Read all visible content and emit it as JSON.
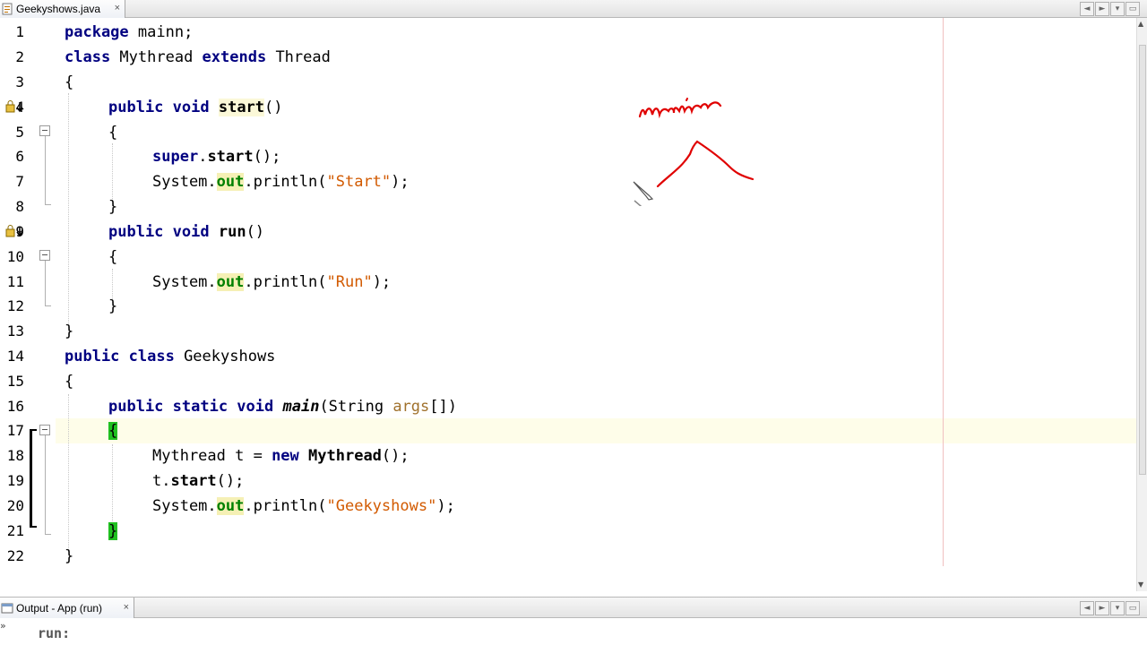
{
  "editor_tab": {
    "filename": "Geekyshows.java",
    "close": "×"
  },
  "output_tab": {
    "title": "Output - App (run)",
    "close": "×",
    "text": "run:"
  },
  "nav": {
    "left": "◄",
    "right": "►",
    "menu": "▾",
    "restore": "▭"
  },
  "line_numbers": [
    "1",
    "2",
    "3",
    "4",
    "5",
    "6",
    "7",
    "8",
    "9",
    "10",
    "11",
    "12",
    "13",
    "14",
    "15",
    "16",
    "17",
    "18",
    "19",
    "20",
    "21",
    "22"
  ],
  "code": {
    "l1_kw": "package",
    "l1_rest": " mainn;",
    "l2_kw1": "class",
    "l2_name": " Mythread ",
    "l2_kw2": "extends",
    "l2_rest": " Thread",
    "l3": "{",
    "l4_kw": "public void",
    "l4_sp": " ",
    "l4_m": "start",
    "l4_rest": "()",
    "l5": "{",
    "l6_kw": "super",
    "l6_dot": ".",
    "l6_m": "start",
    "l6_rest": "();",
    "l7_pre": "System.",
    "l7_f": "out",
    "l7_mid": ".println(",
    "l7_s": "\"Start\"",
    "l7_end": ");",
    "l8": "}",
    "l9_kw": "public void",
    "l9_sp": " ",
    "l9_m": "run",
    "l9_rest": "()",
    "l10": "{",
    "l11_pre": "System.",
    "l11_f": "out",
    "l11_mid": ".println(",
    "l11_s": "\"Run\"",
    "l11_end": ");",
    "l12": "}",
    "l13": "}",
    "l14_kw": "public class",
    "l14_rest": " Geekyshows",
    "l15": "{",
    "l16_kw": "public static void",
    "l16_sp": " ",
    "l16_m": "main",
    "l16_mid": "(String ",
    "l16_p": "args",
    "l16_end": "[])",
    "l17": "{",
    "l18_pre": "Mythread t = ",
    "l18_kw": "new",
    "l18_sp": " ",
    "l18_m": "Mythread",
    "l18_end": "();",
    "l19_pre": "t.",
    "l19_m": "start",
    "l19_end": "();",
    "l20_pre": "System.",
    "l20_f": "out",
    "l20_mid": ".println(",
    "l20_s": "\"Geekyshows\"",
    "l20_end": ");",
    "l21": "}",
    "l22": "}"
  },
  "annotation": {
    "handwritten": "main",
    "color": "#e00000"
  },
  "colors": {
    "keyword": "#000080",
    "field": "#008000",
    "string": "#cc6600",
    "brace_match": "#20c020"
  }
}
